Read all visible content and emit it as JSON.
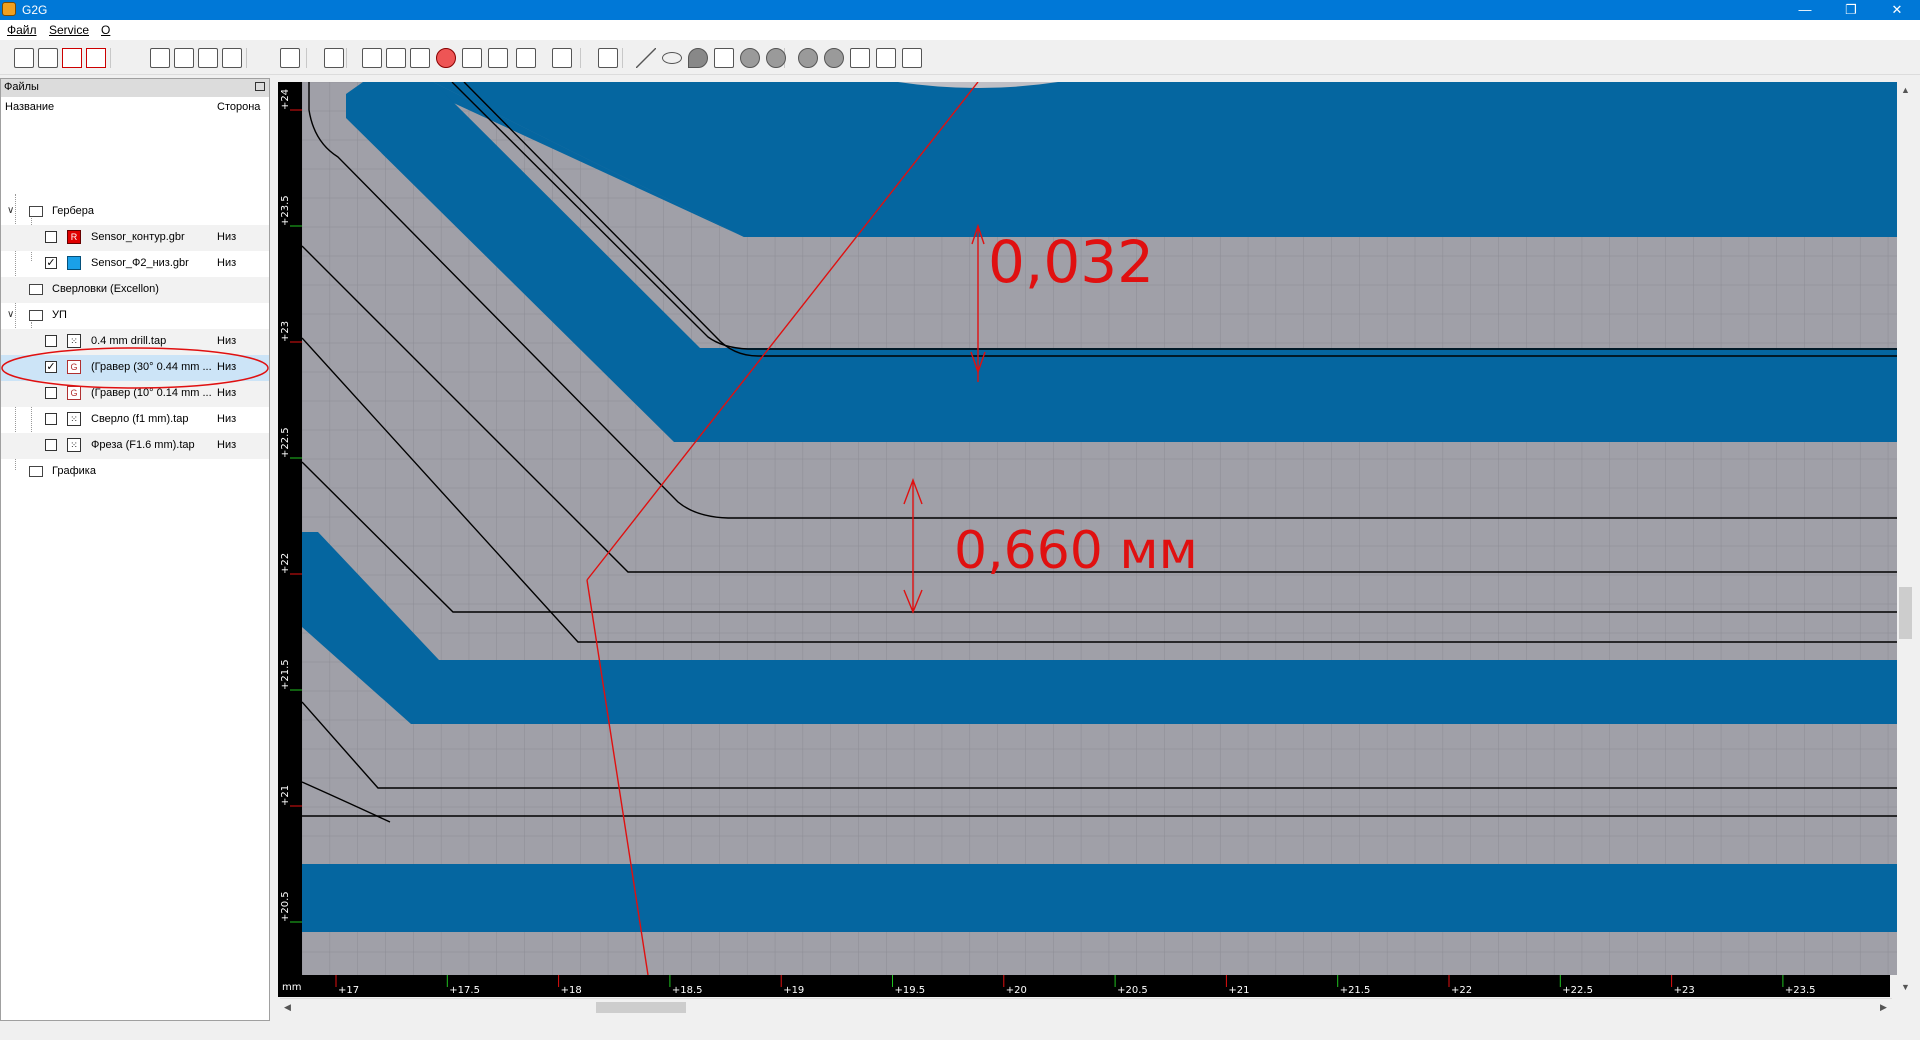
{
  "window": {
    "title": "G2G",
    "controls": {
      "minimize": "—",
      "restore": "❐",
      "close": "✕"
    }
  },
  "menu": {
    "items": [
      "Файл",
      "Service",
      "О"
    ]
  },
  "toolbar": {
    "icons": [
      "open-folder-icon",
      "save-all-icon",
      "close-file-icon",
      "close-all-icon",
      "zoom-fit-icon",
      "zoom-extents-icon",
      "zoom-in-icon",
      "zoom-out-icon",
      "ruler-icon",
      "select-icon",
      "gerber-layer-icon",
      "pocket-icon",
      "profile-icon",
      "drill-icon",
      "voronoi-icon",
      "thermal-icon",
      "settings-icon",
      "fit-icon",
      "rectangle-icon",
      "line-icon",
      "ellipse-icon",
      "arc-icon",
      "text-icon",
      "union-icon",
      "difference-icon",
      "intersection-icon",
      "exclusive-icon"
    ]
  },
  "files_panel": {
    "title": "Файлы",
    "columns": {
      "name": "Название",
      "side": "Сторона"
    },
    "tree": [
      {
        "type": "group",
        "label": "Гербера",
        "expanded": true
      },
      {
        "type": "file",
        "label": "Sensor_контур.gbr",
        "side": "Низ",
        "checked": false,
        "color": "#e00000",
        "icon_text": "R"
      },
      {
        "type": "file",
        "label": "Sensor_Ф2_низ.gbr",
        "side": "Низ",
        "checked": true,
        "color": "#1aa0e8",
        "icon_text": ""
      },
      {
        "type": "group",
        "label": "Сверловки (Excellon)",
        "expanded": false
      },
      {
        "type": "group",
        "label": "УП",
        "expanded": true
      },
      {
        "type": "file",
        "label": "0.4 mm drill.tap",
        "side": "Низ",
        "checked": false,
        "icon_text": "⁙"
      },
      {
        "type": "file",
        "label": "(Гравер (30° 0.44 mm ...",
        "side": "Низ",
        "checked": true,
        "icon_text": "G",
        "highlighted": true
      },
      {
        "type": "file",
        "label": "(Гравер (10° 0.14 mm ...",
        "side": "Низ",
        "checked": false,
        "icon_text": "G"
      },
      {
        "type": "file",
        "label": "Сверло (f1 mm).tap",
        "side": "Низ",
        "checked": false,
        "icon_text": "⁙"
      },
      {
        "type": "file",
        "label": "Фреза (F1.6 mm).tap",
        "side": "Низ",
        "checked": false,
        "icon_text": "⁙"
      },
      {
        "type": "group",
        "label": "Графика",
        "expanded": false
      }
    ]
  },
  "canvas": {
    "unit_label": "mm",
    "x_ticks": [
      "+17",
      "+17.5",
      "+18",
      "+18.5",
      "+19",
      "+19.5",
      "+20",
      "+20.5",
      "+21",
      "+21.5",
      "+22",
      "+22.5",
      "+23",
      "+23.5"
    ],
    "y_ticks": [
      "+24",
      "+23.5",
      "+23",
      "+22.5",
      "+22",
      "+21.5",
      "+21",
      "+20.5"
    ],
    "annotations": [
      "0,032",
      "0,660 мм"
    ],
    "colors": {
      "background": "#a0a0a8",
      "copper": "#0566a0",
      "grid": "#8c8c94",
      "annotation": "#e01010",
      "toolpath": "#000000",
      "ruler": "#000000"
    }
  }
}
